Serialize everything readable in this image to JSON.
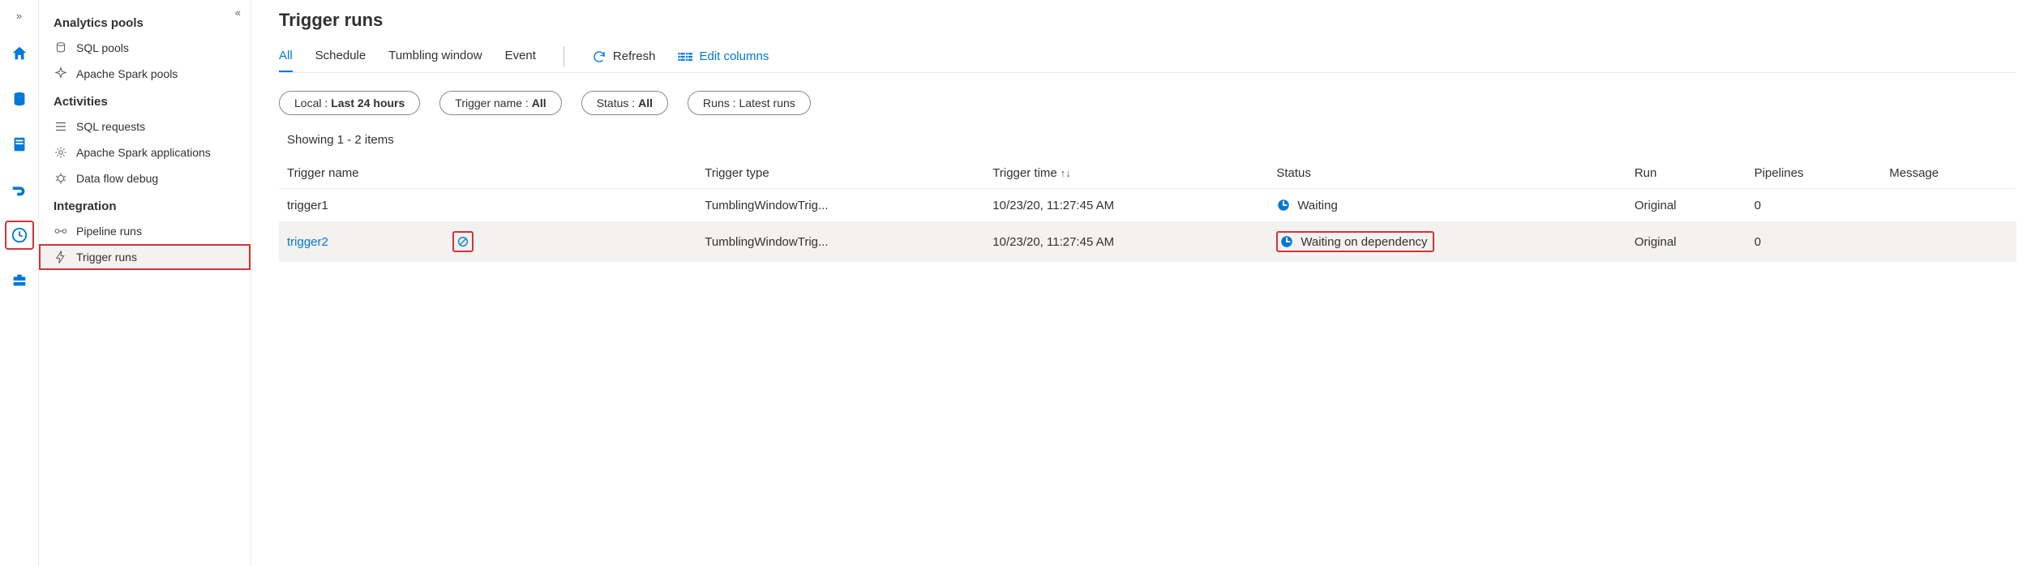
{
  "sidebar": {
    "sections": [
      {
        "header": "Analytics pools",
        "items": [
          {
            "id": "sql-pools",
            "label": "SQL pools"
          },
          {
            "id": "spark-pools",
            "label": "Apache Spark pools"
          }
        ]
      },
      {
        "header": "Activities",
        "items": [
          {
            "id": "sql-requests",
            "label": "SQL requests"
          },
          {
            "id": "spark-apps",
            "label": "Apache Spark applications"
          },
          {
            "id": "data-flow-debug",
            "label": "Data flow debug"
          }
        ]
      },
      {
        "header": "Integration",
        "items": [
          {
            "id": "pipeline-runs",
            "label": "Pipeline runs"
          },
          {
            "id": "trigger-runs",
            "label": "Trigger runs"
          }
        ]
      }
    ],
    "selected": "trigger-runs"
  },
  "page": {
    "title": "Trigger runs",
    "tabs": [
      "All",
      "Schedule",
      "Tumbling window",
      "Event"
    ],
    "active_tab": "All",
    "refresh_label": "Refresh",
    "edit_columns_label": "Edit columns"
  },
  "filters": {
    "local": {
      "prefix": "Local : ",
      "value": "Last 24 hours"
    },
    "name": {
      "prefix": "Trigger name : ",
      "value": "All"
    },
    "status": {
      "prefix": "Status : ",
      "value": "All"
    },
    "runs": {
      "prefix": "Runs : ",
      "value": "Latest runs"
    }
  },
  "showing_text": "Showing 1 - 2 items",
  "columns": [
    "Trigger name",
    "Trigger type",
    "Trigger time",
    "Status",
    "Run",
    "Pipelines",
    "Message"
  ],
  "sort_column": "Trigger time",
  "rows": [
    {
      "name": "trigger1",
      "type": "TumblingWindowTrig...",
      "time": "10/23/20, 11:27:45 AM",
      "status": "Waiting",
      "run": "Original",
      "pipelines": "0",
      "message": "",
      "selected": false,
      "status_highlighted": false,
      "show_cancel": false,
      "name_is_link": false
    },
    {
      "name": "trigger2",
      "type": "TumblingWindowTrig...",
      "time": "10/23/20, 11:27:45 AM",
      "status": "Waiting on dependency",
      "run": "Original",
      "pipelines": "0",
      "message": "",
      "selected": true,
      "status_highlighted": true,
      "show_cancel": true,
      "name_is_link": true
    }
  ],
  "colors": {
    "accent": "#0078d4",
    "highlight": "#d13438"
  }
}
